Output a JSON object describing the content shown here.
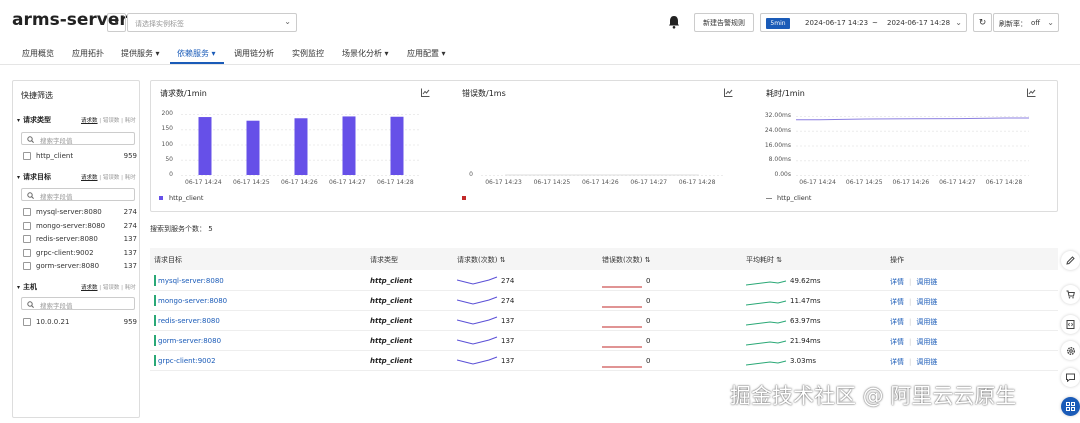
{
  "app": {
    "title": "arms-server",
    "caret": "▾",
    "tag_placeholder": "请选择实例标签"
  },
  "toolbar": {
    "new_alert_rule": "新建告警规则",
    "time_preset": "5min",
    "time_from": "2024-06-17 14:23",
    "time_sep": "~",
    "time_to": "2024-06-17 14:28",
    "refresh_label": "刷新率：",
    "refresh_value": "off"
  },
  "nav": {
    "tabs": [
      {
        "label": "应用概览"
      },
      {
        "label": "应用拓扑"
      },
      {
        "label": "提供服务 ▾"
      },
      {
        "label": "依赖服务 ▾",
        "active": true
      },
      {
        "label": "调用链分析"
      },
      {
        "label": "实例监控"
      },
      {
        "label": "场景化分析 ▾"
      },
      {
        "label": "应用配置 ▾"
      }
    ]
  },
  "sidebar": {
    "title": "快捷筛选",
    "mode_labels": [
      "请求数",
      "错误数",
      "耗时"
    ],
    "search_placeholder": "搜索字段值",
    "sections": [
      {
        "label": "请求类型",
        "items": [
          {
            "name": "http_client",
            "count": "959"
          }
        ]
      },
      {
        "label": "请求目标",
        "items": [
          {
            "name": "mysql-server:8080",
            "count": "274"
          },
          {
            "name": "mongo-server:8080",
            "count": "274"
          },
          {
            "name": "redis-server:8080",
            "count": "137"
          },
          {
            "name": "grpc-client:9002",
            "count": "137"
          },
          {
            "name": "gorm-server:8080",
            "count": "137"
          }
        ]
      },
      {
        "label": "主机",
        "items": [
          {
            "name": "10.0.0.21",
            "count": "959"
          }
        ]
      }
    ]
  },
  "charts": {
    "requests_title": "请求数/1min",
    "errors_title": "错误数/1ms",
    "latency_title": "耗时/1min"
  },
  "chart_data": [
    {
      "type": "bar",
      "title": "请求数/1min",
      "categories": [
        "06-17 14:24",
        "06-17 14:25",
        "06-17 14:26",
        "06-17 14:27",
        "06-17 14:28"
      ],
      "yticks": [
        "200",
        "150",
        "100",
        "50",
        "0"
      ],
      "ylim": [
        0,
        200
      ],
      "series": [
        {
          "name": "http_client",
          "values": [
            190,
            178,
            186,
            192,
            191
          ]
        }
      ],
      "color": "#6650e8",
      "legend": "bottom-left"
    },
    {
      "type": "line",
      "title": "错误数/1ms",
      "categories": [
        "06-17 14:23",
        "06-17 14:25",
        "06-17 14:26",
        "06-17 14:27",
        "06-17 14:28"
      ],
      "yticks": [
        "0"
      ],
      "series": [
        {
          "name": "",
          "values": [
            0,
            0,
            0,
            0,
            0
          ]
        }
      ],
      "color": "#c22a2a",
      "legend": "bottom-left"
    },
    {
      "type": "line",
      "title": "耗时/1min",
      "categories": [
        "06-17 14:24",
        "06-17 14:25",
        "06-17 14:26",
        "06-17 14:27",
        "06-17 14:28"
      ],
      "yticks": [
        "32.00ms",
        "24.00ms",
        "16.00ms",
        "8.00ms",
        "0.00s"
      ],
      "ylim": [
        0,
        32
      ],
      "series": [
        {
          "name": "http_client",
          "values": [
            30.0,
            30.4,
            30.5,
            30.6,
            30.9
          ]
        }
      ],
      "color": "#8b7fe0",
      "legend": "bottom-left"
    }
  ],
  "summary": {
    "service_count_label": "搜索到服务个数：",
    "service_count": "5"
  },
  "table": {
    "headers": {
      "target": "请求目标",
      "type": "请求类型",
      "requests": "请求数(次数)",
      "errors": "错误数(次数)",
      "latency": "平均耗时",
      "actions": "操作"
    },
    "sort_icon": "⇅",
    "action_detail": "详情",
    "action_trace": "调用链",
    "rows": [
      {
        "target": "mysql-server:8080",
        "type": "http_client",
        "requests": "274",
        "errors": "0",
        "latency": "49.62ms"
      },
      {
        "target": "mongo-server:8080",
        "type": "http_client",
        "requests": "274",
        "errors": "0",
        "latency": "11.47ms"
      },
      {
        "target": "redis-server:8080",
        "type": "http_client",
        "requests": "137",
        "errors": "0",
        "latency": "63.97ms"
      },
      {
        "target": "gorm-server:8080",
        "type": "http_client",
        "requests": "137",
        "errors": "0",
        "latency": "21.94ms"
      },
      {
        "target": "grpc-client:9002",
        "type": "http_client",
        "requests": "137",
        "errors": "0",
        "latency": "3.03ms"
      }
    ]
  },
  "floating_tools": [
    "edit-icon",
    "cart-icon",
    "code-icon",
    "gear-icon",
    "chat-icon",
    "apps-icon"
  ],
  "watermark": "掘金技术社区 @ 阿里云云原生",
  "colors": {
    "accent": "#1a5bb8",
    "bar": "#6650e8",
    "error": "#c22a2a",
    "latency_spark": "#2aa876",
    "req_spark": "#5a4fd6"
  }
}
